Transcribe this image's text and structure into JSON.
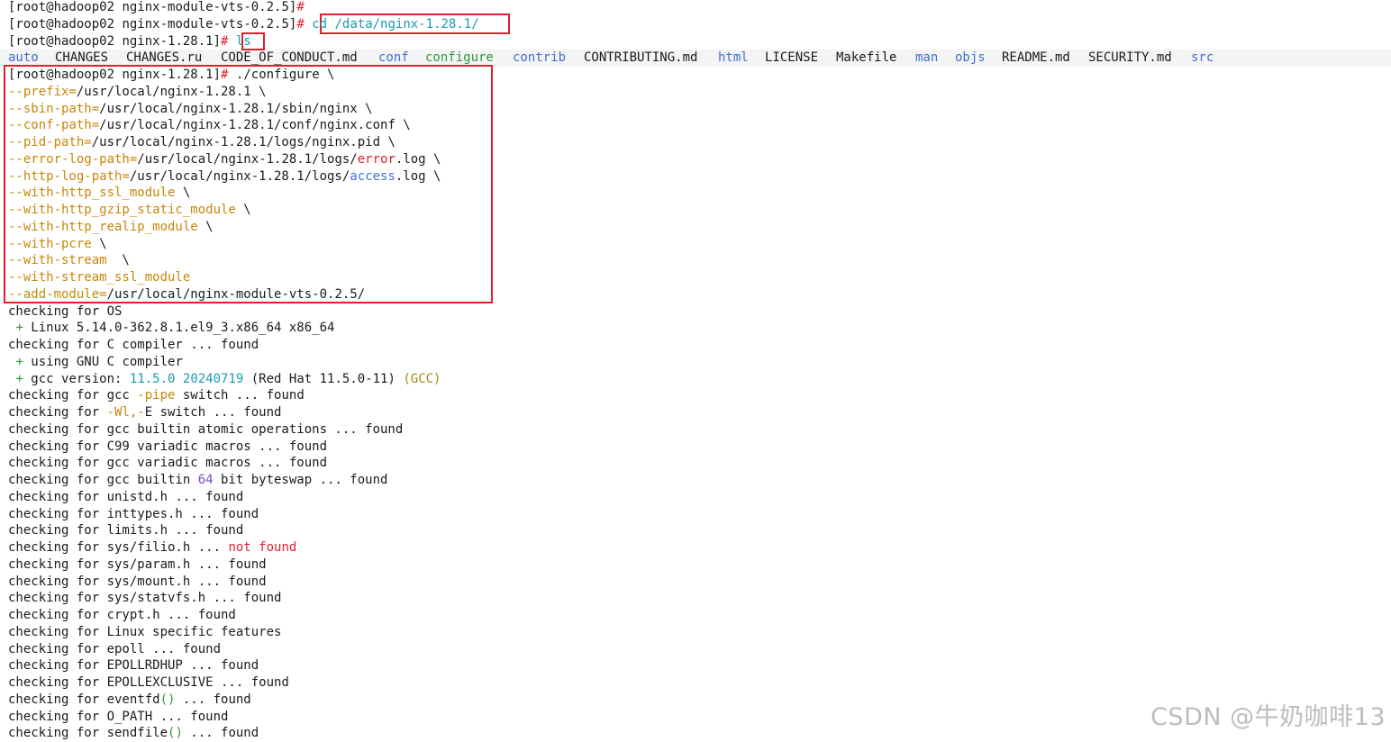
{
  "prompts": [
    {
      "user": "[root@hadoop02",
      "dir": "nginx-module-vts-0.2.5]",
      "hash": "#",
      "cmd": ""
    },
    {
      "user": "[root@hadoop02",
      "dir": "nginx-module-vts-0.2.5]",
      "hash": "#",
      "cmd": "cd /data/nginx-1.28.1/"
    },
    {
      "user": "[root@hadoop02",
      "dir": "nginx-1.28.1]",
      "hash": "#",
      "cmd": "ls"
    }
  ],
  "ls_output": [
    {
      "name": "auto",
      "type": "dir"
    },
    {
      "name": "CHANGES",
      "type": "file"
    },
    {
      "name": "CHANGES.ru",
      "type": "file"
    },
    {
      "name": "CODE_OF_CONDUCT.md",
      "type": "file"
    },
    {
      "name": "conf",
      "type": "dir"
    },
    {
      "name": "configure",
      "type": "exec"
    },
    {
      "name": "contrib",
      "type": "dir"
    },
    {
      "name": "CONTRIBUTING.md",
      "type": "file"
    },
    {
      "name": "html",
      "type": "dir"
    },
    {
      "name": "LICENSE",
      "type": "file"
    },
    {
      "name": "Makefile",
      "type": "file"
    },
    {
      "name": "man",
      "type": "dir"
    },
    {
      "name": "objs",
      "type": "dir"
    },
    {
      "name": "README.md",
      "type": "file"
    },
    {
      "name": "SECURITY.md",
      "type": "file"
    },
    {
      "name": "src",
      "type": "dir"
    }
  ],
  "configure": {
    "prompt_user": "[root@hadoop02",
    "prompt_dir": "nginx-1.28.1]",
    "prompt_hash": "#",
    "cmd": "./configure \\",
    "options": [
      {
        "flag": "--prefix=",
        "val": "/usr/local/nginx-1.28.1 \\"
      },
      {
        "flag": "--sbin-path=",
        "val": "/usr/local/nginx-1.28.1/sbin/nginx \\"
      },
      {
        "flag": "--conf-path=",
        "val": "/usr/local/nginx-1.28.1/conf/nginx.conf \\"
      },
      {
        "flag": "--pid-path=",
        "val": "/usr/local/nginx-1.28.1/logs/nginx.pid \\"
      },
      {
        "flag": "--error-log-path=",
        "val": "/usr/local/nginx-1.28.1/logs/",
        "hl": "error",
        "hlc": "red",
        "tail": ".log \\"
      },
      {
        "flag": "--http-log-path=",
        "val": "/usr/local/nginx-1.28.1/logs/",
        "hl": "access",
        "hlc": "blue",
        "tail": ".log \\"
      },
      {
        "flag": "--with-http_ssl_module",
        "val": " \\"
      },
      {
        "flag": "--with-http_gzip_static_module",
        "val": " \\"
      },
      {
        "flag": "--with-http_realip_module",
        "val": " \\"
      },
      {
        "flag": "--with-pcre",
        "val": " \\"
      },
      {
        "flag": "--with-stream",
        "val": "  \\"
      },
      {
        "flag": "--with-stream_ssl_module",
        "val": ""
      },
      {
        "flag": "--add-module=",
        "val": "/usr/local/nginx-module-vts-0.2.5/"
      }
    ]
  },
  "output": [
    [
      {
        "t": "checking for OS"
      }
    ],
    [
      {
        "t": " "
      },
      {
        "t": "+",
        "c": "green"
      },
      {
        "t": " Linux 5.14.0-362.8.1.el9_3.x86_64 x86_64"
      }
    ],
    [
      {
        "t": "checking for C compiler ... found"
      }
    ],
    [
      {
        "t": " "
      },
      {
        "t": "+",
        "c": "green"
      },
      {
        "t": " using GNU C compiler"
      }
    ],
    [
      {
        "t": " "
      },
      {
        "t": "+",
        "c": "green"
      },
      {
        "t": " gcc version: "
      },
      {
        "t": "11.5.0 20240719",
        "c": "teal"
      },
      {
        "t": " (Red Hat 11.5.0-11) ",
        "c": "gray"
      },
      {
        "t": "(GCC)",
        "c": "olive"
      }
    ],
    [
      {
        "t": "checking for gcc "
      },
      {
        "t": "-pipe",
        "c": "orange"
      },
      {
        "t": " switch ... found"
      }
    ],
    [
      {
        "t": "checking for "
      },
      {
        "t": "-Wl,-",
        "c": "orange"
      },
      {
        "t": "E switch ... found"
      }
    ],
    [
      {
        "t": "checking for gcc builtin atomic operations ... found"
      }
    ],
    [
      {
        "t": "checking for C99 variadic macros ... found"
      }
    ],
    [
      {
        "t": "checking for gcc variadic macros ... found"
      }
    ],
    [
      {
        "t": "checking for gcc builtin "
      },
      {
        "t": "64",
        "c": "purple"
      },
      {
        "t": " bit byteswap ... found"
      }
    ],
    [
      {
        "t": "checking for unistd.h ... found"
      }
    ],
    [
      {
        "t": "checking for inttypes.h ... found"
      }
    ],
    [
      {
        "t": "checking for limits.h ... found"
      }
    ],
    [
      {
        "t": "checking for sys/filio.h ... "
      },
      {
        "t": "not found",
        "c": "red"
      }
    ],
    [
      {
        "t": "checking for sys/param.h ... found"
      }
    ],
    [
      {
        "t": "checking for sys/mount.h ... found"
      }
    ],
    [
      {
        "t": "checking for sys/statvfs.h ... found"
      }
    ],
    [
      {
        "t": "checking for crypt.h ... found"
      }
    ],
    [
      {
        "t": "checking for Linux specific features"
      }
    ],
    [
      {
        "t": "checking for epoll ... found"
      }
    ],
    [
      {
        "t": "checking for EPOLLRDHUP ... found"
      }
    ],
    [
      {
        "t": "checking for EPOLLEXCLUSIVE ... found"
      }
    ],
    [
      {
        "t": "checking for eventfd"
      },
      {
        "t": "()",
        "c": "green"
      },
      {
        "t": " ... found"
      }
    ],
    [
      {
        "t": "checking for O_PATH ... found"
      }
    ],
    [
      {
        "t": "checking for sendfile"
      },
      {
        "t": "()",
        "c": "green"
      },
      {
        "t": " ... found"
      }
    ]
  ],
  "watermark": "CSDN @牛奶咖啡13"
}
